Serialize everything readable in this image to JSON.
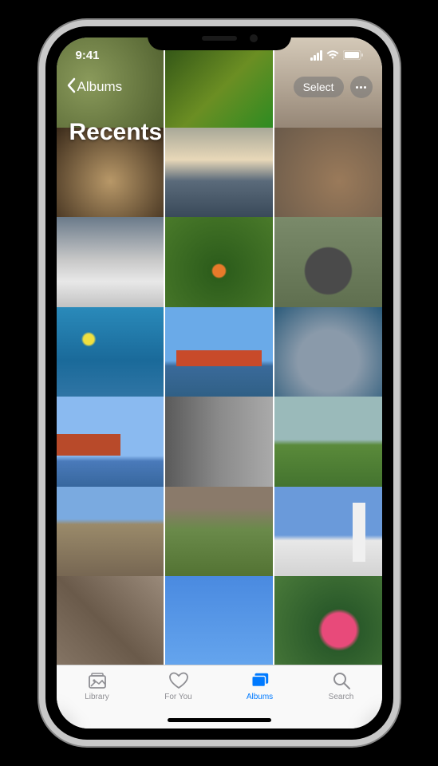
{
  "status": {
    "time": "9:41"
  },
  "nav": {
    "back_label": "Albums",
    "select_label": "Select"
  },
  "title": "Recents",
  "photos": [
    {
      "name": "salad-bowl",
      "bg": "bg-salad",
      "favorite": false
    },
    {
      "name": "green-leaves",
      "bg": "bg-greens",
      "favorite": true,
      "heart_pos": "l"
    },
    {
      "name": "kitchen",
      "bg": "bg-kitchen",
      "favorite": false
    },
    {
      "name": "dog-portrait",
      "bg": "bg-dog",
      "favorite": false
    },
    {
      "name": "coastal-sunset",
      "bg": "bg-sunset",
      "favorite": false
    },
    {
      "name": "desert-ground",
      "bg": "bg-desert",
      "favorite": false
    },
    {
      "name": "snowy-mountain",
      "bg": "bg-mountain",
      "favorite": false
    },
    {
      "name": "monarch-butterfly",
      "bg": "bg-butterfly",
      "favorite": true,
      "heart_pos": "r"
    },
    {
      "name": "water-wheel",
      "bg": "bg-wheel",
      "favorite": false
    },
    {
      "name": "coral-fish",
      "bg": "bg-coral",
      "favorite": false
    },
    {
      "name": "golden-gate-bridge",
      "bg": "bg-bridge",
      "favorite": false
    },
    {
      "name": "stingray",
      "bg": "bg-ray",
      "favorite": true,
      "heart_pos": "r"
    },
    {
      "name": "bridge-view",
      "bg": "bg-bridge2",
      "favorite": true,
      "heart_pos": "l"
    },
    {
      "name": "building-columns",
      "bg": "bg-building",
      "favorite": false
    },
    {
      "name": "green-field-fence",
      "bg": "bg-field",
      "favorite": false
    },
    {
      "name": "downtown-street",
      "bg": "bg-street",
      "favorite": false
    },
    {
      "name": "grass-path",
      "bg": "bg-grass",
      "favorite": false
    },
    {
      "name": "civic-building",
      "bg": "bg-civic",
      "favorite": true,
      "heart_pos": "r"
    },
    {
      "name": "rock-texture",
      "bg": "bg-rock",
      "favorite": false
    },
    {
      "name": "blue-sky",
      "bg": "bg-sky",
      "favorite": false
    },
    {
      "name": "pink-flower",
      "bg": "bg-flower",
      "favorite": false
    }
  ],
  "tabs": [
    {
      "id": "library",
      "label": "Library",
      "icon": "library-icon",
      "active": false
    },
    {
      "id": "foryou",
      "label": "For You",
      "icon": "foryou-icon",
      "active": false
    },
    {
      "id": "albums",
      "label": "Albums",
      "icon": "albums-icon",
      "active": true
    },
    {
      "id": "search",
      "label": "Search",
      "icon": "search-icon",
      "active": false
    }
  ]
}
